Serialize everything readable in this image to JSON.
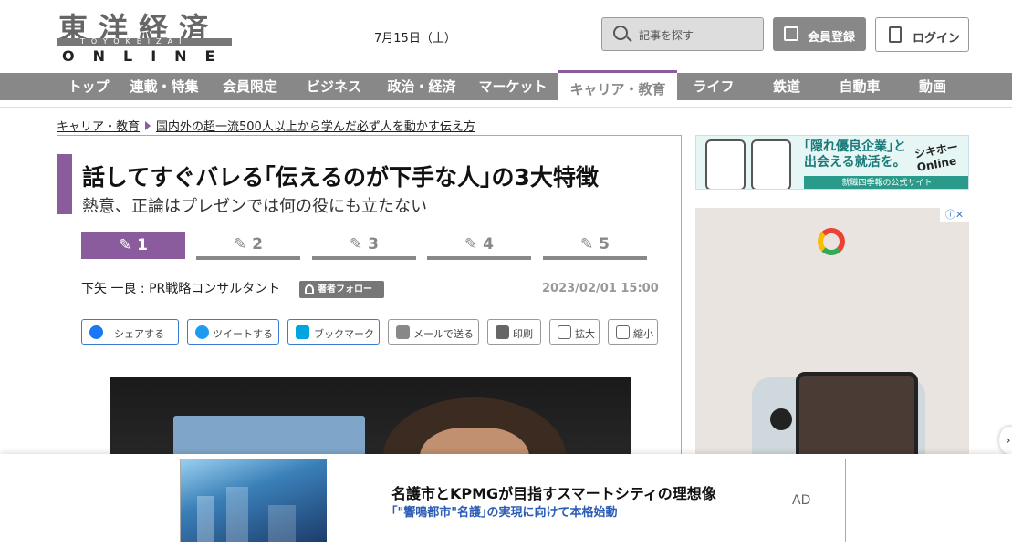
{
  "header": {
    "logo_kanji": "東洋経済",
    "logo_roman": "TOYOKEIZAI",
    "logo_online": "ONLINE",
    "date": "7月15日（土）",
    "search_placeholder": "記事を探す",
    "register_label": "会員登録",
    "login_label": "ログイン"
  },
  "nav": {
    "items": [
      {
        "label": "トップ"
      },
      {
        "label": "連載・特集"
      },
      {
        "label": "会員限定"
      },
      {
        "label": "ビジネス"
      },
      {
        "label": "政治・経済"
      },
      {
        "label": "マーケット"
      },
      {
        "label": "キャリア・教育"
      },
      {
        "label": "ライフ"
      },
      {
        "label": "鉄道"
      },
      {
        "label": "自動車"
      },
      {
        "label": "動画"
      }
    ],
    "active_index": 6
  },
  "breadcrumb": {
    "category": "キャリア・教育",
    "current": "国内外の超一流500人以上から学んだ必ず人を動かす伝え方"
  },
  "article": {
    "title": "話してすぐバレる｢伝えるのが下手な人｣の3大特徴",
    "subtitle": "熱意、正論はプレゼンでは何の役にも立たない",
    "pages": [
      "✎ 1",
      "✎ 2",
      "✎ 3",
      "✎ 4",
      "✎ 5"
    ],
    "active_page": 0,
    "author_name": "下矢 一良",
    "author_role": " : PR戦略コンサルタント",
    "follow_label": "著者フォロー",
    "timestamp": "2023/02/01 15:00",
    "share_buttons": [
      {
        "label": "シェアする",
        "icon": "facebook-icon",
        "color": "#1877f2"
      },
      {
        "label": "ツイートする",
        "icon": "twitter-icon",
        "color": "#1d9bf0"
      },
      {
        "label": "ブックマーク",
        "icon": "hatena-bookmark-icon",
        "color": "#00a4de"
      },
      {
        "label": "メールで送る",
        "icon": "mail-icon",
        "color": "#666666"
      },
      {
        "label": "印刷",
        "icon": "print-icon",
        "color": "#666666"
      },
      {
        "label": "拡大",
        "icon": "zoom-in-icon",
        "color": "#666666"
      },
      {
        "label": "縮小",
        "icon": "zoom-out-icon",
        "color": "#666666"
      }
    ]
  },
  "ads": {
    "top_banner": {
      "copy_line1": "｢隠れ優良企業｣と",
      "copy_line2": "出会える就活を。",
      "brand": "シキホーOnline",
      "footer": "就職四季報の公式サイト"
    },
    "side_ad_icon": "ⓘ✕",
    "bottom": {
      "headline": "名護市とKPMGが目指すスマートシティの理想像",
      "sub": "｢\"響鳴都市\"名護｣の実現に向けて本格始動",
      "label": "AD"
    },
    "side_arrow": "›"
  },
  "colors": {
    "accent": "#8a5c9e",
    "nav_bg": "#888888"
  }
}
